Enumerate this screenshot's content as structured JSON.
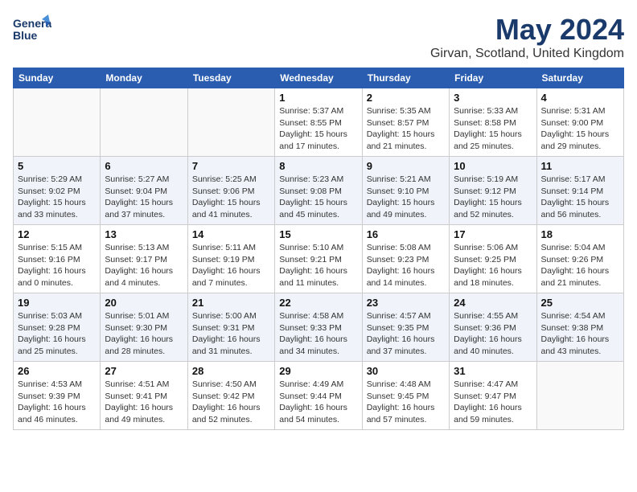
{
  "header": {
    "logo_line1": "General",
    "logo_line2": "Blue",
    "month": "May 2024",
    "location": "Girvan, Scotland, United Kingdom"
  },
  "weekdays": [
    "Sunday",
    "Monday",
    "Tuesday",
    "Wednesday",
    "Thursday",
    "Friday",
    "Saturday"
  ],
  "weeks": [
    [
      {
        "day": "",
        "info": ""
      },
      {
        "day": "",
        "info": ""
      },
      {
        "day": "",
        "info": ""
      },
      {
        "day": "1",
        "info": "Sunrise: 5:37 AM\nSunset: 8:55 PM\nDaylight: 15 hours\nand 17 minutes."
      },
      {
        "day": "2",
        "info": "Sunrise: 5:35 AM\nSunset: 8:57 PM\nDaylight: 15 hours\nand 21 minutes."
      },
      {
        "day": "3",
        "info": "Sunrise: 5:33 AM\nSunset: 8:58 PM\nDaylight: 15 hours\nand 25 minutes."
      },
      {
        "day": "4",
        "info": "Sunrise: 5:31 AM\nSunset: 9:00 PM\nDaylight: 15 hours\nand 29 minutes."
      }
    ],
    [
      {
        "day": "5",
        "info": "Sunrise: 5:29 AM\nSunset: 9:02 PM\nDaylight: 15 hours\nand 33 minutes."
      },
      {
        "day": "6",
        "info": "Sunrise: 5:27 AM\nSunset: 9:04 PM\nDaylight: 15 hours\nand 37 minutes."
      },
      {
        "day": "7",
        "info": "Sunrise: 5:25 AM\nSunset: 9:06 PM\nDaylight: 15 hours\nand 41 minutes."
      },
      {
        "day": "8",
        "info": "Sunrise: 5:23 AM\nSunset: 9:08 PM\nDaylight: 15 hours\nand 45 minutes."
      },
      {
        "day": "9",
        "info": "Sunrise: 5:21 AM\nSunset: 9:10 PM\nDaylight: 15 hours\nand 49 minutes."
      },
      {
        "day": "10",
        "info": "Sunrise: 5:19 AM\nSunset: 9:12 PM\nDaylight: 15 hours\nand 52 minutes."
      },
      {
        "day": "11",
        "info": "Sunrise: 5:17 AM\nSunset: 9:14 PM\nDaylight: 15 hours\nand 56 minutes."
      }
    ],
    [
      {
        "day": "12",
        "info": "Sunrise: 5:15 AM\nSunset: 9:16 PM\nDaylight: 16 hours\nand 0 minutes."
      },
      {
        "day": "13",
        "info": "Sunrise: 5:13 AM\nSunset: 9:17 PM\nDaylight: 16 hours\nand 4 minutes."
      },
      {
        "day": "14",
        "info": "Sunrise: 5:11 AM\nSunset: 9:19 PM\nDaylight: 16 hours\nand 7 minutes."
      },
      {
        "day": "15",
        "info": "Sunrise: 5:10 AM\nSunset: 9:21 PM\nDaylight: 16 hours\nand 11 minutes."
      },
      {
        "day": "16",
        "info": "Sunrise: 5:08 AM\nSunset: 9:23 PM\nDaylight: 16 hours\nand 14 minutes."
      },
      {
        "day": "17",
        "info": "Sunrise: 5:06 AM\nSunset: 9:25 PM\nDaylight: 16 hours\nand 18 minutes."
      },
      {
        "day": "18",
        "info": "Sunrise: 5:04 AM\nSunset: 9:26 PM\nDaylight: 16 hours\nand 21 minutes."
      }
    ],
    [
      {
        "day": "19",
        "info": "Sunrise: 5:03 AM\nSunset: 9:28 PM\nDaylight: 16 hours\nand 25 minutes."
      },
      {
        "day": "20",
        "info": "Sunrise: 5:01 AM\nSunset: 9:30 PM\nDaylight: 16 hours\nand 28 minutes."
      },
      {
        "day": "21",
        "info": "Sunrise: 5:00 AM\nSunset: 9:31 PM\nDaylight: 16 hours\nand 31 minutes."
      },
      {
        "day": "22",
        "info": "Sunrise: 4:58 AM\nSunset: 9:33 PM\nDaylight: 16 hours\nand 34 minutes."
      },
      {
        "day": "23",
        "info": "Sunrise: 4:57 AM\nSunset: 9:35 PM\nDaylight: 16 hours\nand 37 minutes."
      },
      {
        "day": "24",
        "info": "Sunrise: 4:55 AM\nSunset: 9:36 PM\nDaylight: 16 hours\nand 40 minutes."
      },
      {
        "day": "25",
        "info": "Sunrise: 4:54 AM\nSunset: 9:38 PM\nDaylight: 16 hours\nand 43 minutes."
      }
    ],
    [
      {
        "day": "26",
        "info": "Sunrise: 4:53 AM\nSunset: 9:39 PM\nDaylight: 16 hours\nand 46 minutes."
      },
      {
        "day": "27",
        "info": "Sunrise: 4:51 AM\nSunset: 9:41 PM\nDaylight: 16 hours\nand 49 minutes."
      },
      {
        "day": "28",
        "info": "Sunrise: 4:50 AM\nSunset: 9:42 PM\nDaylight: 16 hours\nand 52 minutes."
      },
      {
        "day": "29",
        "info": "Sunrise: 4:49 AM\nSunset: 9:44 PM\nDaylight: 16 hours\nand 54 minutes."
      },
      {
        "day": "30",
        "info": "Sunrise: 4:48 AM\nSunset: 9:45 PM\nDaylight: 16 hours\nand 57 minutes."
      },
      {
        "day": "31",
        "info": "Sunrise: 4:47 AM\nSunset: 9:47 PM\nDaylight: 16 hours\nand 59 minutes."
      },
      {
        "day": "",
        "info": ""
      }
    ]
  ]
}
